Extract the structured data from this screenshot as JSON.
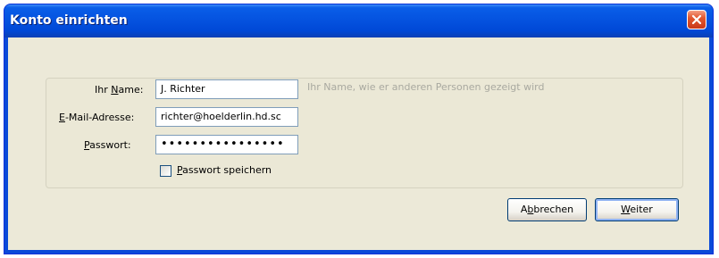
{
  "window": {
    "title": "Konto einrichten"
  },
  "form": {
    "name_label_pre": "Ihr ",
    "name_label_key": "N",
    "name_label_post": "ame:",
    "name_value": "J. Richter",
    "name_hint": "Ihr Name, wie er anderen Personen gezeigt wird",
    "email_label_key": "E",
    "email_label_post": "-Mail-Adresse:",
    "email_value": "richter@hoelderlin.hd.sc",
    "password_label_key": "P",
    "password_label_post": "asswort:",
    "password_value": "••••••••••••••••",
    "save_password_key": "P",
    "save_password_post": "asswort speichern",
    "save_password_checked": false
  },
  "buttons": {
    "cancel_pre": "A",
    "cancel_key": "b",
    "cancel_post": "brechen",
    "next_key": "W",
    "next_post": "eiter"
  }
}
